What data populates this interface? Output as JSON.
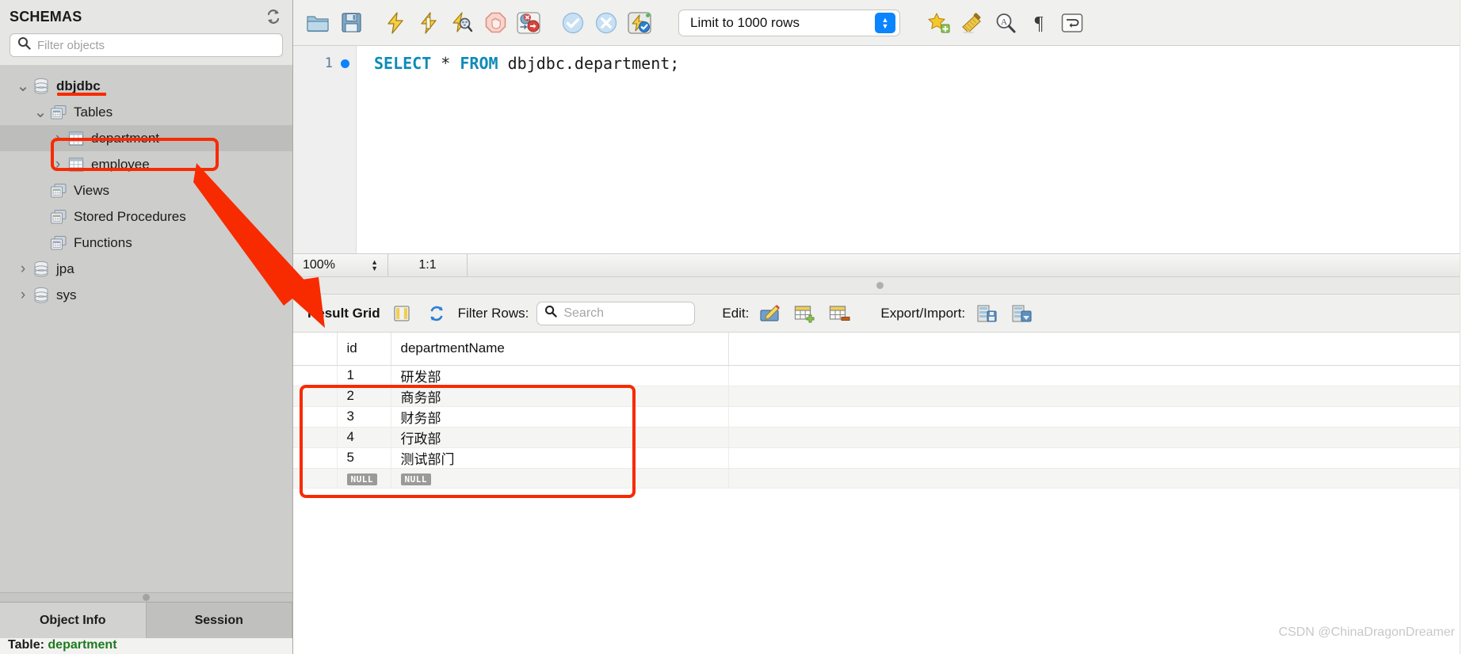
{
  "sidebar": {
    "title": "SCHEMAS",
    "refresh_icon": "refresh-icon",
    "filter": {
      "placeholder": "Filter objects",
      "value": "",
      "icon": "search-icon"
    },
    "tree": [
      {
        "label": "dbjdbc",
        "level": 0,
        "icon": "database-icon",
        "twisty": "expanded",
        "bold": true,
        "selected": false,
        "underlined": true
      },
      {
        "label": "Tables",
        "level": 1,
        "icon": "tables-folder-icon",
        "twisty": "expanded",
        "bold": false,
        "selected": false,
        "underlined": false
      },
      {
        "label": "department",
        "level": 2,
        "icon": "table-icon",
        "twisty": "collapsed",
        "bold": false,
        "selected": true,
        "underlined": false
      },
      {
        "label": "employee",
        "level": 2,
        "icon": "table-icon",
        "twisty": "collapsed",
        "bold": false,
        "selected": false,
        "underlined": false
      },
      {
        "label": "Views",
        "level": 1,
        "icon": "views-folder-icon",
        "twisty": "none",
        "bold": false,
        "selected": false,
        "underlined": false
      },
      {
        "label": "Stored Procedures",
        "level": 1,
        "icon": "procedures-folder-icon",
        "twisty": "none",
        "bold": false,
        "selected": false,
        "underlined": false
      },
      {
        "label": "Functions",
        "level": 1,
        "icon": "functions-folder-icon",
        "twisty": "none",
        "bold": false,
        "selected": false,
        "underlined": false
      },
      {
        "label": "jpa",
        "level": 0,
        "icon": "database-icon",
        "twisty": "collapsed",
        "bold": false,
        "selected": false,
        "underlined": false
      },
      {
        "label": "sys",
        "level": 0,
        "icon": "database-icon",
        "twisty": "collapsed",
        "bold": false,
        "selected": false,
        "underlined": false
      }
    ],
    "bottom_tabs": [
      {
        "label": "Object Info",
        "active": false
      },
      {
        "label": "Session",
        "active": true
      }
    ],
    "object_info": {
      "prefix": "Table:",
      "name": "department"
    }
  },
  "toolbar": {
    "buttons": [
      {
        "name": "open-sql-file-button",
        "icon": "folder-icon"
      },
      {
        "name": "save-sql-file-button",
        "icon": "floppy-disk-icon"
      },
      {
        "name": "execute-statement-button",
        "icon": "lightning-icon"
      },
      {
        "name": "execute-current-statement-button",
        "icon": "lightning-cursor-icon"
      },
      {
        "name": "explain-statement-button",
        "icon": "lightning-magnifier-icon"
      },
      {
        "name": "stop-button",
        "icon": "stop-hand-icon"
      },
      {
        "name": "toggle-stop-on-error-button",
        "icon": "stop-on-error-icon"
      },
      {
        "name": "commit-button",
        "icon": "check-circle-icon"
      },
      {
        "name": "rollback-button",
        "icon": "x-circle-icon"
      },
      {
        "name": "toggle-autocommit-button",
        "icon": "autocommit-icon"
      }
    ],
    "limit_select": {
      "label": "Limit to 1000 rows",
      "stepper_icon": "chevron-updown-icon",
      "accent": "#0a84ff"
    },
    "right_buttons": [
      {
        "name": "save-snippet-button",
        "icon": "star-plus-icon"
      },
      {
        "name": "beautify-sql-button",
        "icon": "broom-icon"
      },
      {
        "name": "find-button",
        "icon": "magnifier-a-icon"
      },
      {
        "name": "toggle-invisible-chars-button",
        "icon": "pilcrow-icon"
      },
      {
        "name": "toggle-word-wrap-button",
        "icon": "wrap-arrow-icon"
      }
    ]
  },
  "editor": {
    "line_number": "1",
    "breakpoint_marker": "blue-dot",
    "query": {
      "kw1": "SELECT",
      "star": "*",
      "kw2": "FROM",
      "target": "dbjdbc.department;"
    },
    "status": {
      "zoom": "100%",
      "position": "1:1"
    }
  },
  "results": {
    "title": "Result Grid",
    "grid_view_icon": "grid-columns-icon",
    "refresh_icon": "refresh-arrows-icon",
    "filter_label": "Filter Rows:",
    "search": {
      "placeholder": "Search",
      "value": "",
      "icon": "search-icon"
    },
    "edit_label": "Edit:",
    "edit_buttons": [
      {
        "name": "edit-row-button",
        "icon": "pencil-icon"
      },
      {
        "name": "insert-row-button",
        "icon": "table-add-icon"
      },
      {
        "name": "delete-row-button",
        "icon": "table-delete-icon"
      }
    ],
    "export_import_label": "Export/Import:",
    "export_buttons": [
      {
        "name": "export-recordset-button",
        "icon": "export-disk-icon"
      },
      {
        "name": "import-recordset-button",
        "icon": "import-disk-icon"
      }
    ],
    "columns": [
      "",
      "id",
      "departmentName",
      ""
    ],
    "rows": [
      {
        "id": "1",
        "departmentName": "研发部",
        "null": false
      },
      {
        "id": "2",
        "departmentName": "商务部",
        "null": false
      },
      {
        "id": "3",
        "departmentName": "财务部",
        "null": false
      },
      {
        "id": "4",
        "departmentName": "行政部",
        "null": false
      },
      {
        "id": "5",
        "departmentName": "测试部门",
        "null": false
      },
      {
        "id": "NULL",
        "departmentName": "NULL",
        "null": true
      }
    ]
  },
  "annotations": {
    "accent_color": "#f82a00",
    "watermark": "CSDN @ChinaDragonDreamer"
  }
}
